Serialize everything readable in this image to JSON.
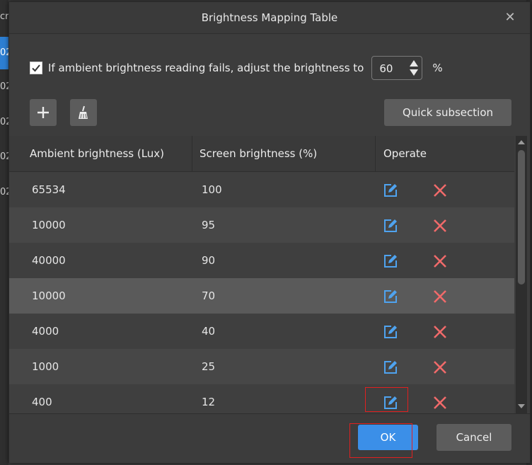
{
  "background": {
    "left_items": [
      "cro",
      "02",
      "02",
      "02",
      "02",
      "02"
    ],
    "selected_index": 1
  },
  "dialog": {
    "title": "Brightness Mapping Table",
    "close_glyph": "✕"
  },
  "fallback": {
    "checked": true,
    "label": "If ambient brightness reading fails, adjust the brightness to",
    "value": "60",
    "unit": "%"
  },
  "toolbar": {
    "add_icon": "plus-icon",
    "clear_icon": "broom-icon",
    "quick_subsection_label": "Quick subsection"
  },
  "table": {
    "columns": [
      "Ambient brightness (Lux)",
      "Screen brightness (%)",
      "Operate"
    ],
    "rows": [
      {
        "ambient": "65534",
        "screen": "100"
      },
      {
        "ambient": "10000",
        "screen": "95"
      },
      {
        "ambient": "40000",
        "screen": "90"
      },
      {
        "ambient": "10000",
        "screen": "70"
      },
      {
        "ambient": "4000",
        "screen": "40"
      },
      {
        "ambient": "1000",
        "screen": "25"
      },
      {
        "ambient": "400",
        "screen": "12"
      }
    ],
    "highlighted_row": 3,
    "edit_icon": "edit-icon",
    "delete_icon": "delete-icon"
  },
  "footer": {
    "ok_label": "OK",
    "cancel_label": "Cancel"
  },
  "colors": {
    "accent": "#3b8fe8",
    "edit": "#4fa3ef",
    "delete": "#f06a6a",
    "annotation": "#e02020"
  }
}
